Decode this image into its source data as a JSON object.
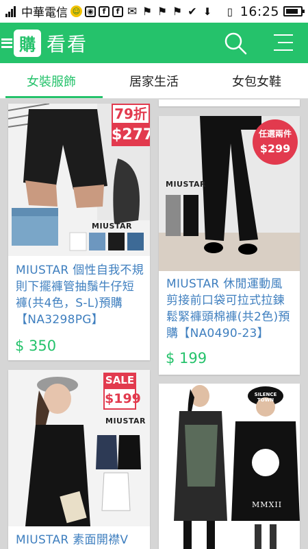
{
  "status_bar": {
    "carrier": "中華電信",
    "time": "16:25",
    "icons": [
      "signal-icon",
      "smiley-icon",
      "camera-icon",
      "facebook-icon",
      "facebook-icon",
      "mail-icon",
      "flag-icon",
      "flag-icon",
      "flag-icon",
      "check-icon",
      "download-icon",
      "vibrate-icon",
      "battery-icon"
    ]
  },
  "app_bar": {
    "logo_text": "購",
    "title": "看看",
    "accent_color": "#25c26b"
  },
  "tabs": [
    {
      "label": "女裝服飾",
      "active": true
    },
    {
      "label": "居家生活",
      "active": false
    },
    {
      "label": "女包女鞋",
      "active": false
    }
  ],
  "products": [
    {
      "title": "MIUSTAR 個性自我不規則下擺褲管抽鬚牛仔短褲(共4色，S-L)預購【NA3298PG】",
      "price": "$ 350",
      "badge_line1": "79折",
      "badge_line2": "$277",
      "brand": "MIUSTAR"
    },
    {
      "title": "MIUSTAR 休閒運動風剪接前口袋可拉式拉鍊鬆緊褲頭棉褲(共2色)預購【NA0490-23】",
      "price": "$ 199",
      "badge_line1": "任選兩件",
      "badge_line2": "$299",
      "brand": "MIUSTAR"
    },
    {
      "title": "MIUSTAR 素面開襟V",
      "price": "",
      "badge_line1": "SALE",
      "badge_line2": "$199",
      "brand": "MIUSTAR"
    },
    {
      "title": "",
      "price": "",
      "cap_text": "SILENCE TOWN",
      "shirt_text": "MMXII"
    }
  ]
}
